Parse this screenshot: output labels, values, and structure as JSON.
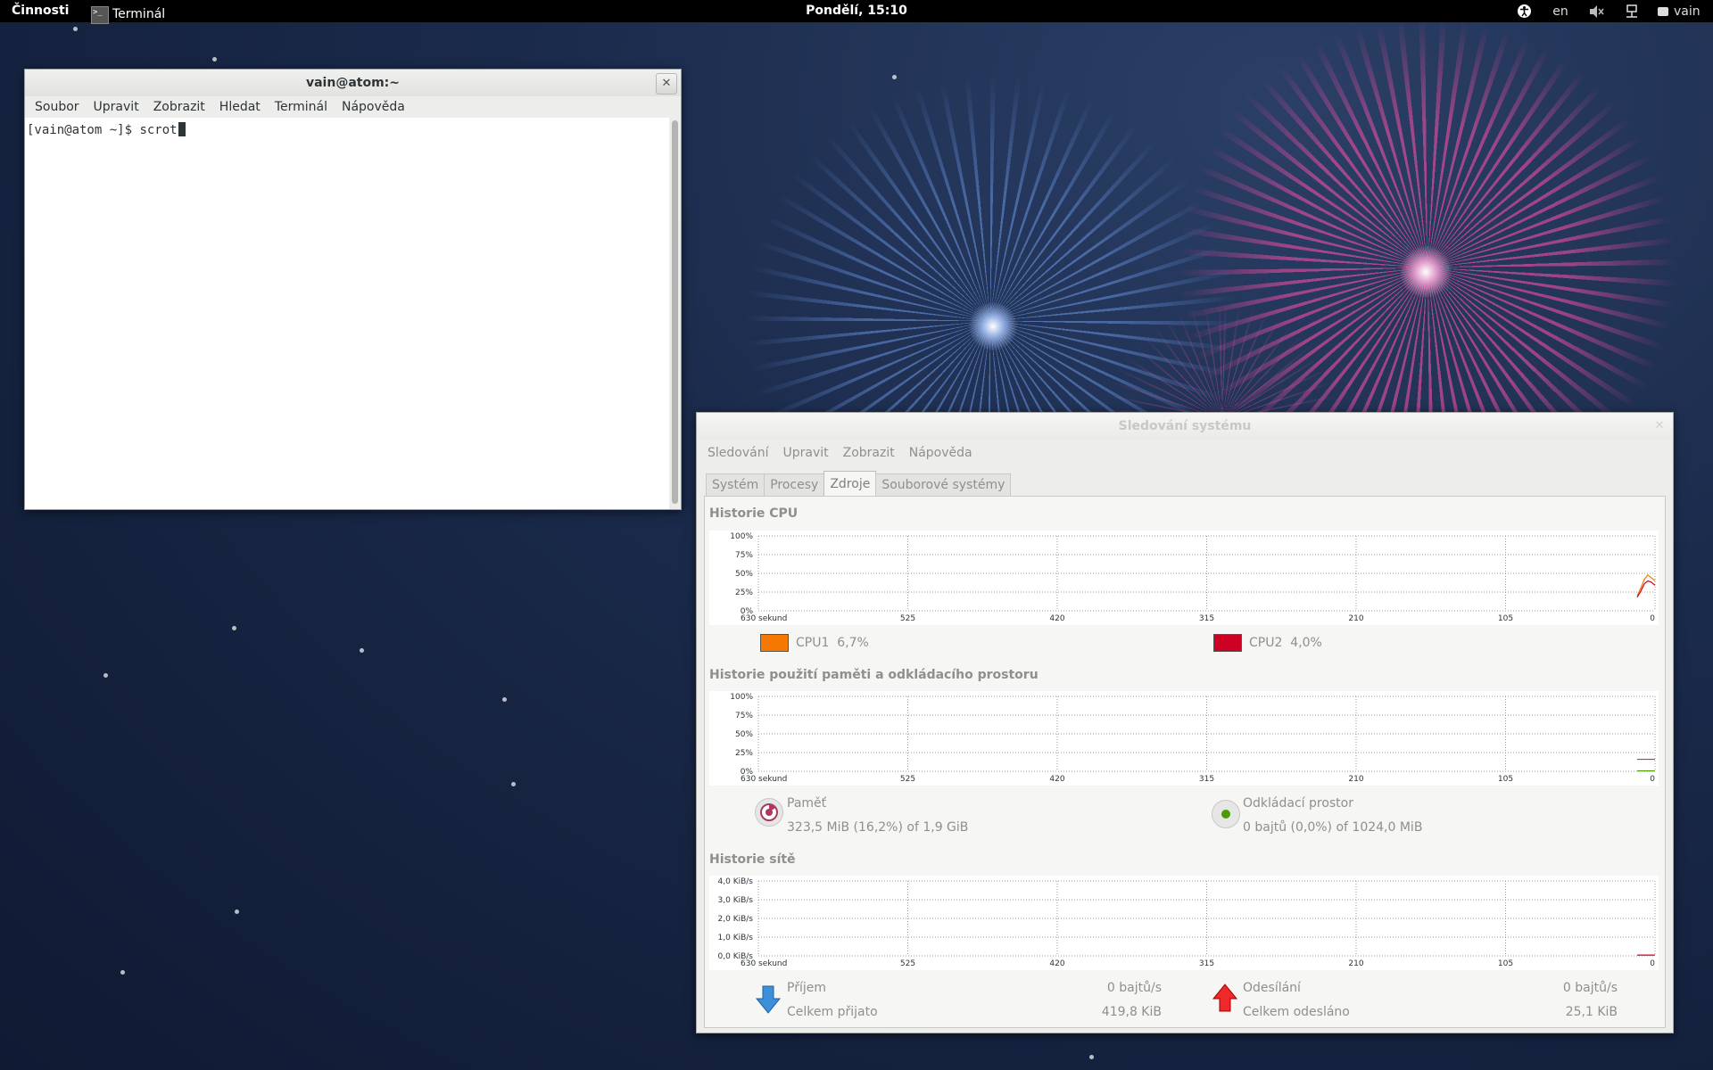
{
  "topbar": {
    "activities": "Činnosti",
    "app_name": "Terminál",
    "clock": "Pondělí, 15:10",
    "keyboard_layout": "en",
    "user": "vain"
  },
  "terminal": {
    "title": "vain@atom:~",
    "menu": [
      "Soubor",
      "Upravit",
      "Zobrazit",
      "Hledat",
      "Terminál",
      "Nápověda"
    ],
    "prompt": "[vain@atom ~]$ ",
    "command": "scrot"
  },
  "sysmon": {
    "title": "Sledování systému",
    "menu": [
      "Sledování",
      "Upravit",
      "Zobrazit",
      "Nápověda"
    ],
    "tabs": [
      "Systém",
      "Procesy",
      "Zdroje",
      "Souborové systémy"
    ],
    "active_tab": "Zdroje",
    "cpu": {
      "title": "Historie CPU",
      "legend": [
        {
          "label": "CPU1",
          "value": "6,7%",
          "color": "#f57900"
        },
        {
          "label": "CPU2",
          "value": "4,0%",
          "color": "#cc0022"
        }
      ]
    },
    "mem": {
      "title": "Historie použití paměti a odkládacího prostoru",
      "memory_label": "Paměť",
      "memory_value": "323,5 MiB (16,2%) of 1,9 GiB",
      "swap_label": "Odkládací prostor",
      "swap_value": "0 bajtů (0,0%) of 1024,0 MiB"
    },
    "net": {
      "title": "Historie sítě",
      "rx_label": "Příjem",
      "rx_rate": "0 bajtů/s",
      "rx_total_label": "Celkem přijato",
      "rx_total": "419,8 KiB",
      "tx_label": "Odesílání",
      "tx_rate": "0 bajtů/s",
      "tx_total_label": "Celkem odesláno",
      "tx_total": "25,1 KiB"
    },
    "percent_ticks": [
      "100%",
      "75%",
      "50%",
      "25%",
      "0%"
    ],
    "net_ticks": [
      "4,0 KiB/s",
      "3,0 KiB/s",
      "2,0 KiB/s",
      "1,0 KiB/s",
      "0,0 KiB/s"
    ],
    "x_ticks": [
      "630 sekund",
      "525",
      "420",
      "315",
      "210",
      "105",
      "0"
    ]
  },
  "colors": {
    "cpu1": "#f57900",
    "cpu2": "#cc0022",
    "memory": "#ad3861",
    "swap": "#4e9a06"
  }
}
